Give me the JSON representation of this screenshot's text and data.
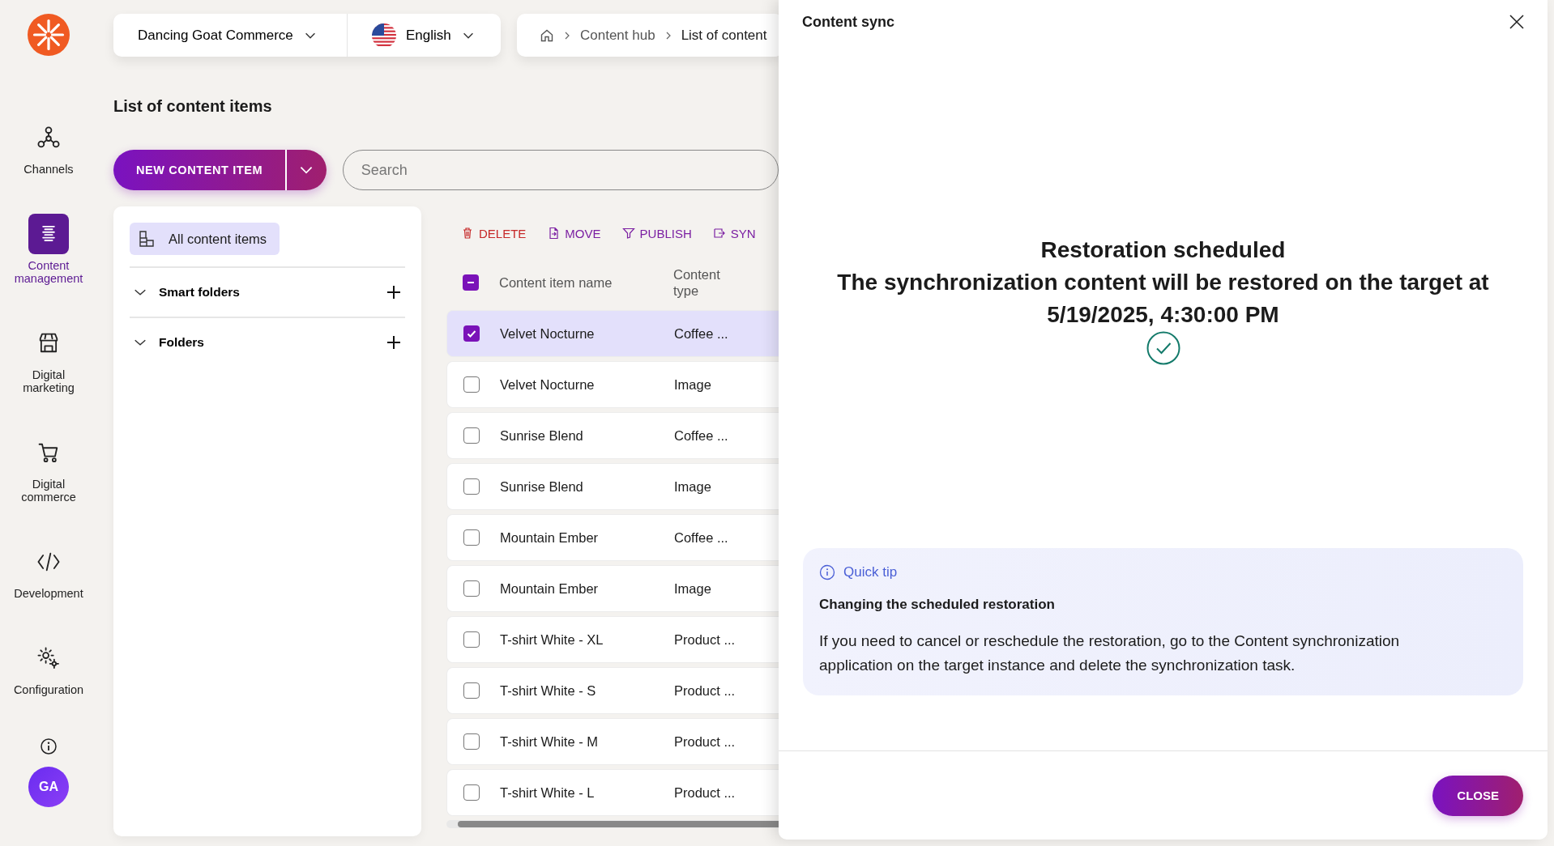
{
  "sidebar": {
    "items": [
      {
        "label": "Channels",
        "selected": false
      },
      {
        "label": "Content management",
        "selected": true
      },
      {
        "label": "Digital marketing",
        "selected": false
      },
      {
        "label": "Digital commerce",
        "selected": false
      },
      {
        "label": "Development",
        "selected": false
      },
      {
        "label": "Configuration",
        "selected": false
      }
    ],
    "avatar": "GA"
  },
  "topbar": {
    "site": "Dancing Goat Commerce",
    "language": "English",
    "breadcrumb": [
      "Content hub",
      "List of content"
    ]
  },
  "page_title": "List of content items",
  "new_button": "NEW CONTENT ITEM",
  "search": {
    "placeholder": "Search"
  },
  "tree": [
    {
      "label": "All content items",
      "kind": "root",
      "selected": true
    },
    {
      "label": "Smart folders",
      "kind": "group",
      "expanded": true
    },
    {
      "label": "Folders",
      "kind": "group",
      "expanded": true
    }
  ],
  "actions": [
    {
      "label": "DELETE",
      "kind": "danger"
    },
    {
      "label": "MOVE",
      "kind": "normal"
    },
    {
      "label": "PUBLISH",
      "kind": "normal"
    },
    {
      "label": "SYN",
      "kind": "normal"
    }
  ],
  "table": {
    "select_all": {
      "indeterminate": true
    },
    "columns": [
      "Content item name",
      "Content type"
    ],
    "rows": [
      {
        "name": "Velvet Nocturne",
        "type": "Coffee ...",
        "selected": true
      },
      {
        "name": "Velvet Nocturne",
        "type": "Image",
        "selected": false
      },
      {
        "name": "Sunrise Blend",
        "type": "Coffee ...",
        "selected": false
      },
      {
        "name": "Sunrise Blend",
        "type": "Image",
        "selected": false
      },
      {
        "name": "Mountain Ember",
        "type": "Coffee ...",
        "selected": false
      },
      {
        "name": "Mountain Ember",
        "type": "Image",
        "selected": false
      },
      {
        "name": "T-shirt White - XL",
        "type": "Product ...",
        "selected": false
      },
      {
        "name": "T-shirt White - S",
        "type": "Product ...",
        "selected": false
      },
      {
        "name": "T-shirt White - M",
        "type": "Product ...",
        "selected": false
      },
      {
        "name": "T-shirt White - L",
        "type": "Product ...",
        "selected": false
      }
    ]
  },
  "dialog": {
    "title": "Content sync",
    "heading": "Restoration scheduled",
    "message": "The synchronization content will be restored on the target at 5/19/2025, 4:30:00 PM",
    "tip": {
      "label": "Quick tip",
      "title": "Changing the scheduled restoration",
      "text": "If you need to cancel or reschedule the restoration, go to the Content synchronization application on the target instance and delete the synchronization task."
    },
    "close_button": "CLOSE"
  }
}
